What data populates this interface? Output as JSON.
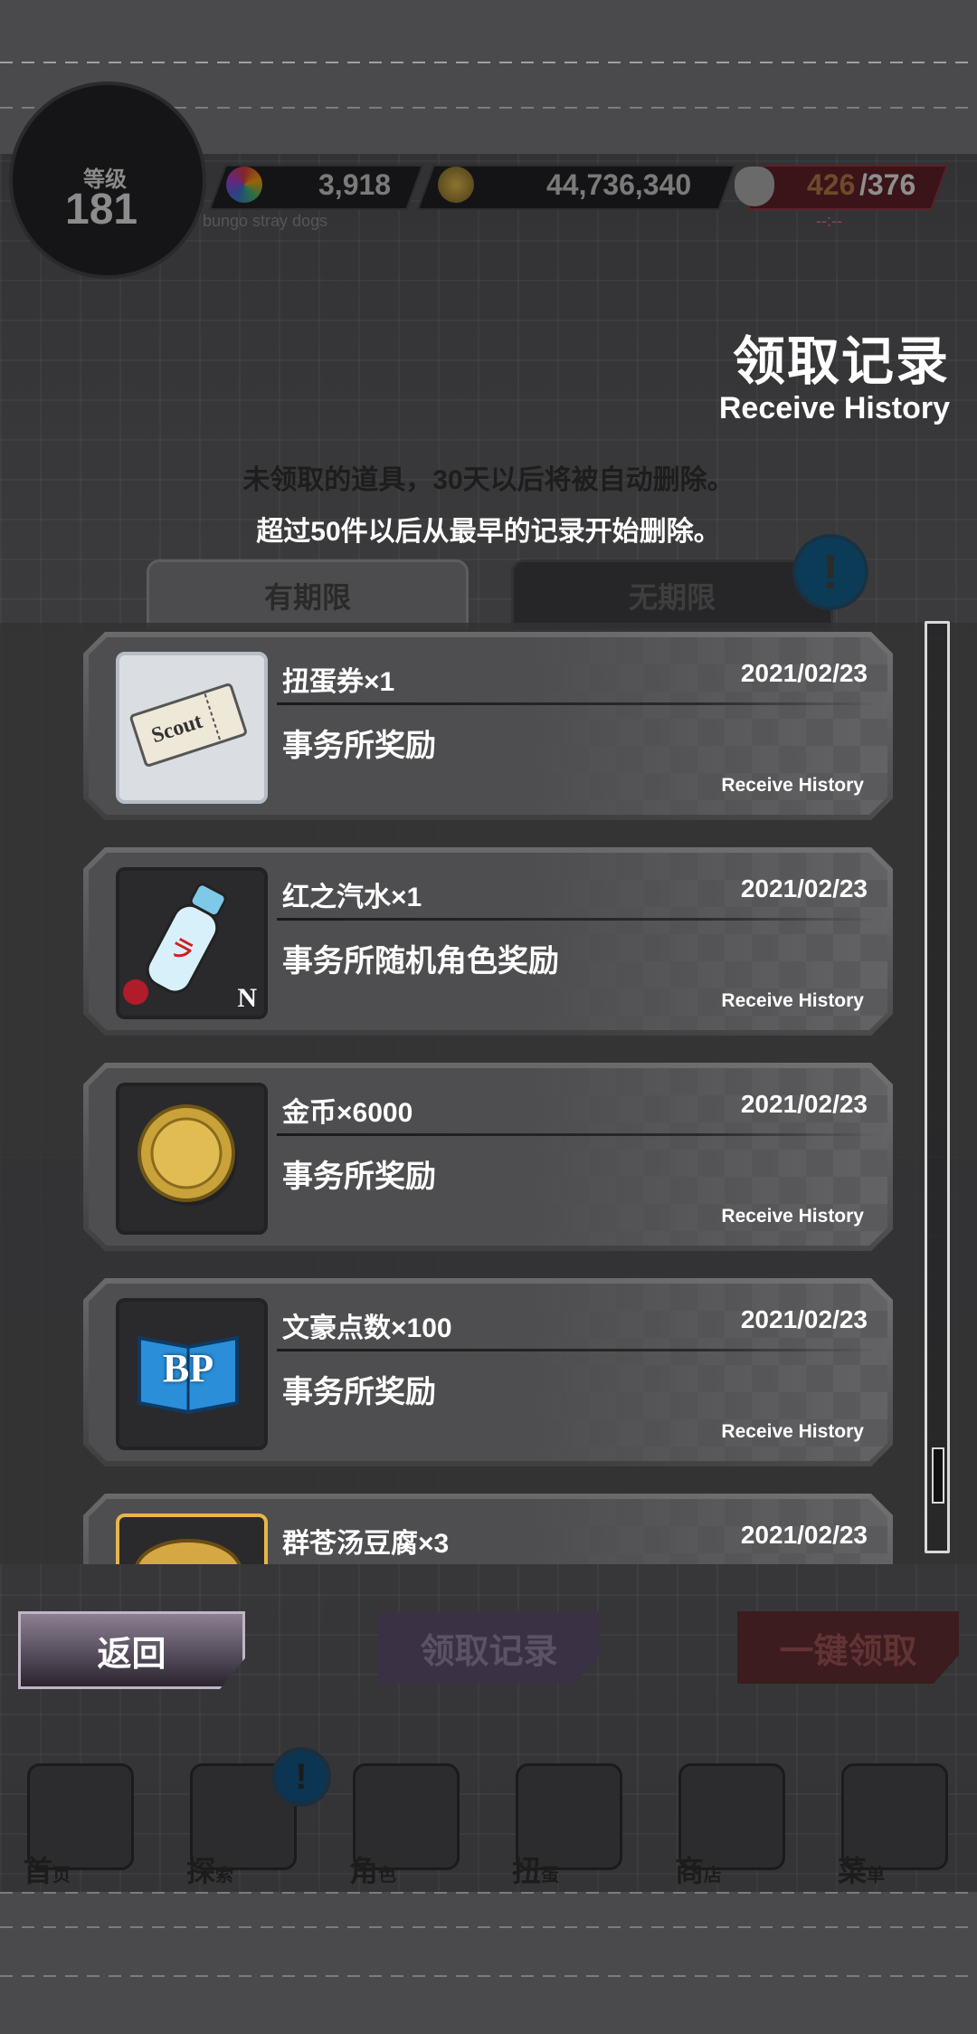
{
  "status": {
    "level_label": "等级",
    "level": "181",
    "gems": "3,918",
    "coins": "44,736,340",
    "stamina_current": "426",
    "stamina_max": "/376",
    "stamina_sub": "--:--",
    "brand": "bungo stray dogs"
  },
  "header": {
    "title_cn": "领取记录",
    "title_en": "Receive History",
    "notice_line1": "未领取的道具，30天以后将被自动删除。",
    "notice_line2": "超过50件以后从最早的记录开始删除。"
  },
  "tabs": {
    "limited": "有期限",
    "unlimited": "无期限"
  },
  "records": [
    {
      "name": "扭蛋券×1",
      "date": "2021/02/23",
      "source": "事务所奖励",
      "footer": "Receive History",
      "icon": "scout-ticket-icon"
    },
    {
      "name": "红之汽水×1",
      "date": "2021/02/23",
      "source": "事务所随机角色奖励",
      "footer": "Receive History",
      "icon": "ramune-soda-icon",
      "rarity": "N"
    },
    {
      "name": "金币×6000",
      "date": "2021/02/23",
      "source": "事务所奖励",
      "footer": "Receive History",
      "icon": "gold-coin-icon"
    },
    {
      "name": "文豪点数×100",
      "date": "2021/02/23",
      "source": "事务所奖励",
      "footer": "Receive History",
      "icon": "bp-book-icon",
      "badge": "BP"
    },
    {
      "name": "群苍汤豆腐×3",
      "date": "2021/02/23",
      "source": "",
      "footer": "",
      "icon": "tofu-pot-icon"
    }
  ],
  "buttons": {
    "back": "返回",
    "history": "领取记录",
    "claim_all": "一键领取"
  },
  "nav": [
    {
      "label": "首",
      "sub": "页",
      "icon": "home-icon"
    },
    {
      "label": "探",
      "sub": "索",
      "icon": "explore-icon"
    },
    {
      "label": "角",
      "sub": "色",
      "icon": "characters-icon"
    },
    {
      "label": "扭",
      "sub": "蛋",
      "icon": "gacha-icon"
    },
    {
      "label": "商",
      "sub": "店",
      "icon": "shop-icon"
    },
    {
      "label": "菜",
      "sub": "单",
      "icon": "menu-gear-icon"
    }
  ],
  "colors": {
    "stamina_red": "#a8242c",
    "alert_blue": "#1d7fb8",
    "back_button": "#8b7f92"
  }
}
